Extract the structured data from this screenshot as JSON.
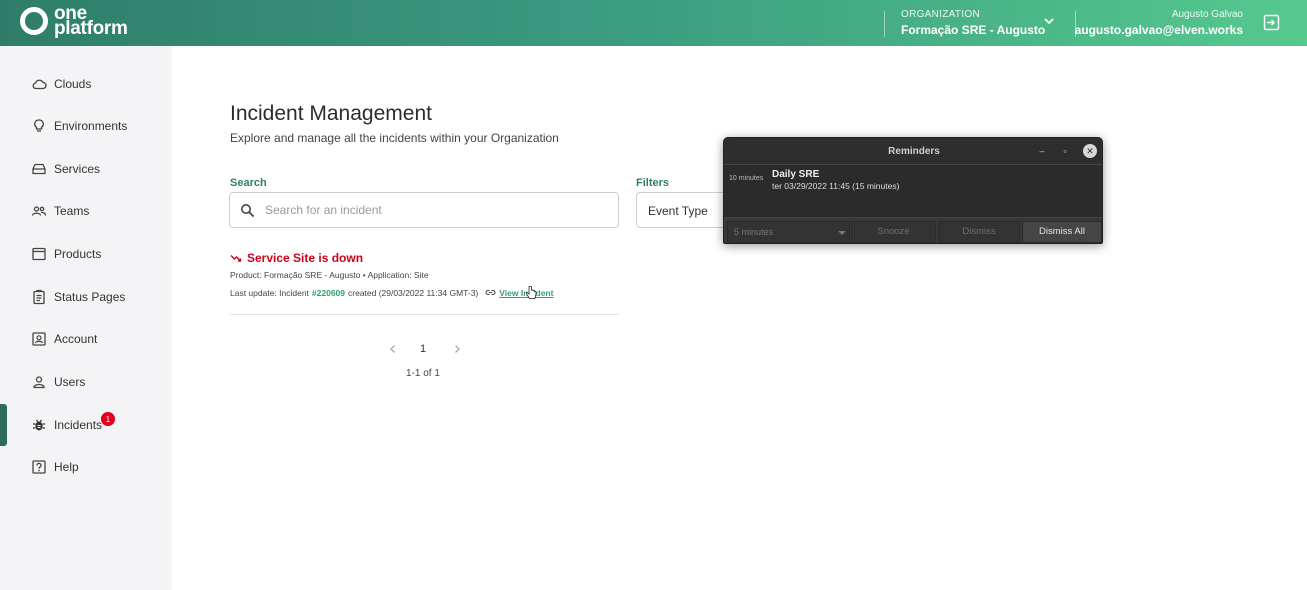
{
  "header": {
    "logo_line1": "one",
    "logo_line2": "platform",
    "org_caption": "ORGANIZATION",
    "org_name": "Formação SRE - Augusto",
    "user_name": "Augusto Galvao",
    "user_email": "augusto.galvao@elven.works",
    "logout_icon": "logout-icon",
    "brand_color": "#2f7d69"
  },
  "sidebar": {
    "items": [
      {
        "label": "Clouds",
        "icon": "cloud-icon"
      },
      {
        "label": "Environments",
        "icon": "bulb-icon"
      },
      {
        "label": "Services",
        "icon": "storage-icon"
      },
      {
        "label": "Teams",
        "icon": "people-icon"
      },
      {
        "label": "Products",
        "icon": "window-icon"
      },
      {
        "label": "Status Pages",
        "icon": "clipboard-icon"
      },
      {
        "label": "Account",
        "icon": "account-box-icon"
      },
      {
        "label": "Users",
        "icon": "person-icon"
      },
      {
        "label": "Incidents",
        "icon": "bug-icon",
        "badge": "1",
        "active": true
      },
      {
        "label": "Help",
        "icon": "help-icon"
      }
    ]
  },
  "main": {
    "title": "Incident Management",
    "subtitle": "Explore and manage all the incidents within your Organization",
    "search": {
      "label": "Search",
      "placeholder": "Search for an incident"
    },
    "filters": {
      "label": "Filters",
      "selected": "Event Type"
    },
    "incident": {
      "title": "Service Site is down",
      "product_line": "Product: Formação SRE - Augusto • Application: Site",
      "update_prefix": "Last update: Incident",
      "incident_number": "#220609",
      "update_suffix": "created (29/03/2022 11:34 GMT-3)",
      "view_link": "View Incident",
      "status_color": "#d0021b"
    },
    "pagination": {
      "page": "1",
      "range": "1-1 of 1"
    }
  },
  "reminders": {
    "title": "Reminders",
    "item": {
      "time_left": "10 minutes",
      "name": "Daily SRE",
      "when": "ter 03/29/2022 11:45  (15 minutes)"
    },
    "snooze_select": "5 minutes",
    "snooze_label": "Snooze",
    "dismiss_label": "Dismiss",
    "dismiss_all_label": "Dismiss All"
  }
}
